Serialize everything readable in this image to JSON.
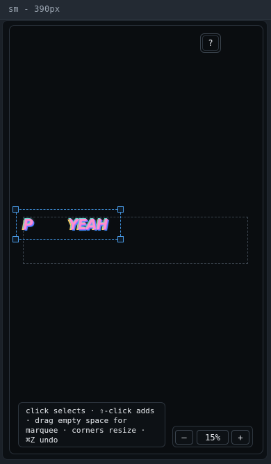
{
  "window": {
    "title": "sm - 390px"
  },
  "help": {
    "label": "?"
  },
  "stickers": [
    {
      "text": "P"
    },
    {
      "text": "YEAH"
    }
  ],
  "hint": {
    "text": "click selects · ⇧-click adds · drag empty space for marquee · corners resize · ⌘Z undo"
  },
  "zoom": {
    "out_label": "–",
    "level": "15%",
    "in_label": "+"
  },
  "colors": {
    "selection": "#3f8ed8",
    "canvas_bg": "#0a0d10",
    "title_bar": "#232a33"
  },
  "icons": {
    "help": "question-mark-icon",
    "zoom_out": "minus-icon",
    "zoom_in": "plus-icon"
  }
}
